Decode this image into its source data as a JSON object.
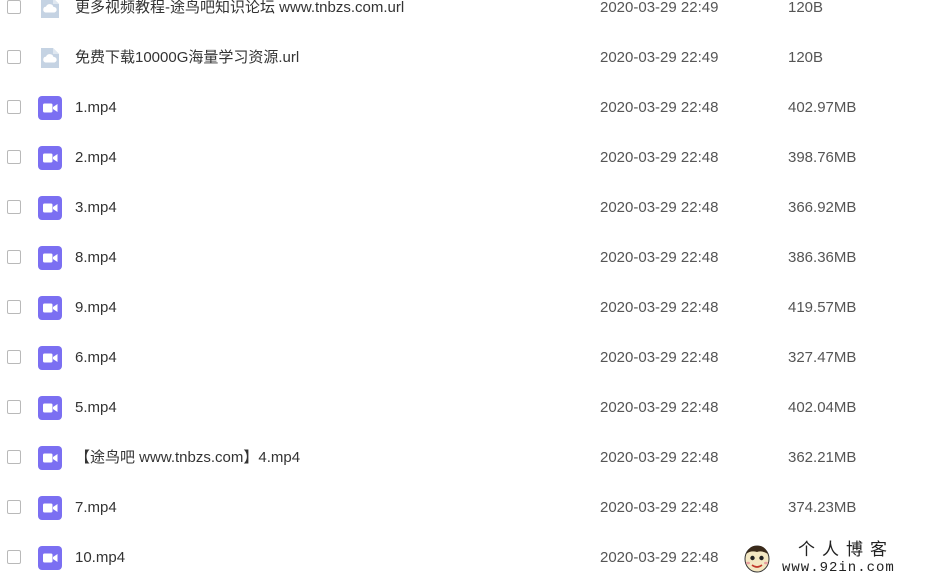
{
  "files": [
    {
      "name": "更多视频教程-途鸟吧知识论坛 www.tnbzs.com.url",
      "date": "2020-03-29 22:49",
      "size": "120B",
      "icon": "cloud-link-icon"
    },
    {
      "name": "免费下载10000G海量学习资源.url",
      "date": "2020-03-29 22:49",
      "size": "120B",
      "icon": "cloud-link-icon"
    },
    {
      "name": "1.mp4",
      "date": "2020-03-29 22:48",
      "size": "402.97MB",
      "icon": "video-file-icon"
    },
    {
      "name": "2.mp4",
      "date": "2020-03-29 22:48",
      "size": "398.76MB",
      "icon": "video-file-icon"
    },
    {
      "name": "3.mp4",
      "date": "2020-03-29 22:48",
      "size": "366.92MB",
      "icon": "video-file-icon"
    },
    {
      "name": "8.mp4",
      "date": "2020-03-29 22:48",
      "size": "386.36MB",
      "icon": "video-file-icon"
    },
    {
      "name": "9.mp4",
      "date": "2020-03-29 22:48",
      "size": "419.57MB",
      "icon": "video-file-icon"
    },
    {
      "name": "6.mp4",
      "date": "2020-03-29 22:48",
      "size": "327.47MB",
      "icon": "video-file-icon"
    },
    {
      "name": "5.mp4",
      "date": "2020-03-29 22:48",
      "size": "402.04MB",
      "icon": "video-file-icon"
    },
    {
      "name": "【途鸟吧 www.tnbzs.com】4.mp4",
      "date": "2020-03-29 22:48",
      "size": "362.21MB",
      "icon": "video-file-icon"
    },
    {
      "name": "7.mp4",
      "date": "2020-03-29 22:48",
      "size": "374.23MB",
      "icon": "video-file-icon"
    },
    {
      "name": "10.mp4",
      "date": "2020-03-29 22:48",
      "size": "",
      "icon": "video-file-icon"
    }
  ],
  "watermark": {
    "title": "个人博客",
    "url": "www.92in.com"
  },
  "colors": {
    "video_icon": "#7b6ff2",
    "link_icon": "#c5d3e3",
    "checkbox_border": "#b9b9b9",
    "text": "#333333",
    "meta_text": "#555555"
  }
}
